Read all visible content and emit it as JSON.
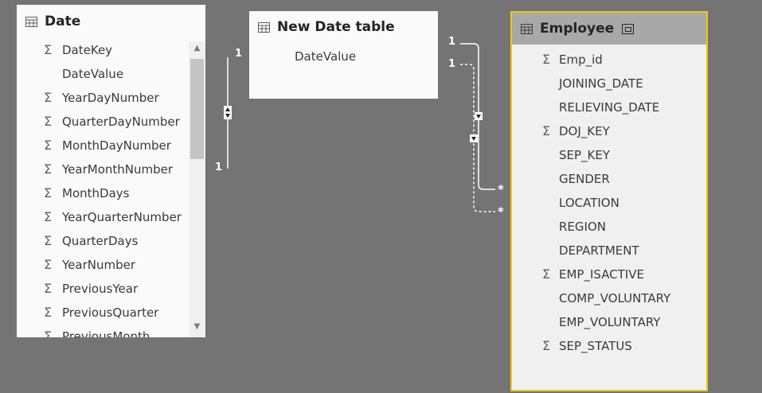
{
  "tables": {
    "date": {
      "title": "Date",
      "fields": [
        {
          "name": "DateKey",
          "sigma": true
        },
        {
          "name": "DateValue",
          "sigma": false
        },
        {
          "name": "YearDayNumber",
          "sigma": true
        },
        {
          "name": "QuarterDayNumber",
          "sigma": true
        },
        {
          "name": "MonthDayNumber",
          "sigma": true
        },
        {
          "name": "YearMonthNumber",
          "sigma": true
        },
        {
          "name": "MonthDays",
          "sigma": true
        },
        {
          "name": "YearQuarterNumber",
          "sigma": true
        },
        {
          "name": "QuarterDays",
          "sigma": true
        },
        {
          "name": "YearNumber",
          "sigma": true
        },
        {
          "name": "PreviousYear",
          "sigma": true
        },
        {
          "name": "PreviousQuarter",
          "sigma": true
        },
        {
          "name": "PreviousMonth",
          "sigma": true
        }
      ]
    },
    "new_date_table": {
      "title": "New Date table",
      "fields": [
        {
          "name": "DateValue",
          "sigma": false
        }
      ]
    },
    "employee": {
      "title": "Employee",
      "fields": [
        {
          "name": "Emp_id",
          "sigma": true
        },
        {
          "name": "JOINING_DATE",
          "sigma": false
        },
        {
          "name": "RELIEVING_DATE",
          "sigma": false
        },
        {
          "name": "DOJ_KEY",
          "sigma": true
        },
        {
          "name": "SEP_KEY",
          "sigma": false
        },
        {
          "name": "GENDER",
          "sigma": false
        },
        {
          "name": "LOCATION",
          "sigma": false
        },
        {
          "name": "REGION",
          "sigma": false
        },
        {
          "name": "DEPARTMENT",
          "sigma": false
        },
        {
          "name": "EMP_ISACTIVE",
          "sigma": true
        },
        {
          "name": "COMP_VOLUNTARY",
          "sigma": false
        },
        {
          "name": "EMP_VOLUNTARY",
          "sigma": false
        },
        {
          "name": "SEP_STATUS",
          "sigma": true
        }
      ]
    }
  },
  "sigma_symbol": "Σ",
  "relationships": {
    "date_to_date": {
      "from_cardinality": "1",
      "to_cardinality": "1",
      "filter_direction": "both"
    },
    "ndt_to_employee_active": {
      "from_cardinality": "1",
      "to_cardinality": "*",
      "filter_direction": "single",
      "active": true
    },
    "ndt_to_employee_inactive": {
      "from_cardinality": "1",
      "to_cardinality": "*",
      "filter_direction": "single",
      "active": false
    }
  },
  "scrollbar": {
    "up_arrow": "▲",
    "down_arrow": "▼"
  },
  "colors": {
    "canvas": "#747474",
    "card": "#fafafa",
    "selected_border": "#f2c811",
    "header_selected": "#a8a8a8"
  }
}
